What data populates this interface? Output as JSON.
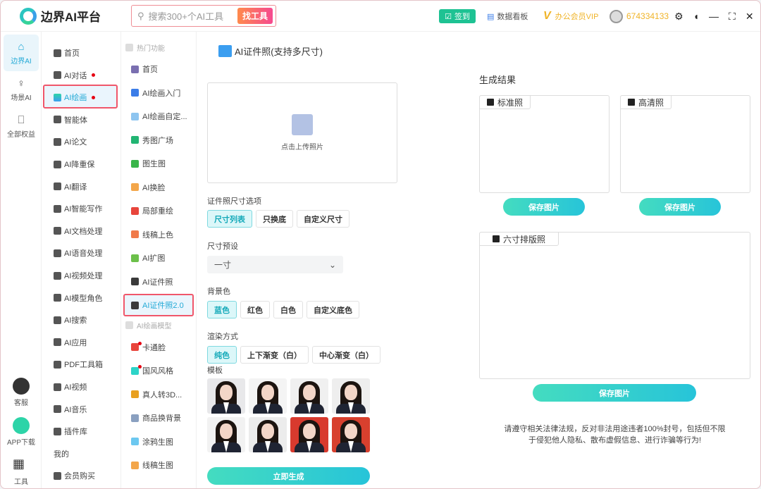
{
  "app": {
    "title": "边界AI平台"
  },
  "search": {
    "placeholder": "搜索300+个AI工具",
    "button": "找工具"
  },
  "toolbar": {
    "sign_in": "签到",
    "dashboard": "数据看板",
    "vip": "办公会员VIP",
    "user_id": "674334133"
  },
  "rail": {
    "items": [
      {
        "label": "边界AI",
        "icon": "home-icon",
        "active": true
      },
      {
        "label": "场景AI",
        "icon": "bulb-icon"
      },
      {
        "label": "全部权益",
        "icon": "bookmark-icon"
      }
    ],
    "bottom": [
      {
        "label": "客服",
        "icon": "headset-icon"
      },
      {
        "label": "APP下载",
        "icon": "phone-download-icon"
      },
      {
        "label": "工具",
        "icon": "grid-plus-icon"
      }
    ]
  },
  "nav1": {
    "items": [
      {
        "label": "首页",
        "icon": "home-icon"
      },
      {
        "label": "AI对话",
        "icon": "cube-icon",
        "dot": true
      },
      {
        "label": "AI绘画",
        "icon": "palette-icon",
        "dot": true,
        "active": true
      },
      {
        "label": "智能体",
        "icon": "robot-icon"
      },
      {
        "label": "AI论文",
        "icon": "document-icon"
      },
      {
        "label": "AI降重保",
        "icon": "list-icon"
      },
      {
        "label": "AI翻译",
        "icon": "translate-icon"
      },
      {
        "label": "AI智能写作",
        "icon": "pen-icon"
      },
      {
        "label": "AI文档处理",
        "icon": "text-icon"
      },
      {
        "label": "AI语音处理",
        "icon": "speaker-icon"
      },
      {
        "label": "AI视频处理",
        "icon": "video-icon"
      },
      {
        "label": "AI模型角色",
        "icon": "box-icon"
      },
      {
        "label": "AI搜索",
        "icon": "search-icon"
      },
      {
        "label": "AI应用",
        "icon": "apps-icon"
      },
      {
        "label": "PDF工具箱",
        "icon": "wrench-icon"
      },
      {
        "label": "AI视频",
        "icon": "play-icon"
      },
      {
        "label": "AI音乐",
        "icon": "music-icon"
      },
      {
        "label": "插件库",
        "icon": "plugin-icon"
      },
      {
        "label": "我的",
        "icon": ""
      },
      {
        "label": "会员购买",
        "icon": "user-icon"
      }
    ]
  },
  "nav2": {
    "sections": [
      {
        "title": "热门功能",
        "items": [
          {
            "label": "首页",
            "color": "#7a6fb0"
          },
          {
            "label": "AI绘画入门",
            "color": "#3b7de8"
          },
          {
            "label": "AI绘画自定...",
            "color": "#8ec5f0"
          },
          {
            "label": "秀图广场",
            "color": "#22b573"
          },
          {
            "label": "图生图",
            "color": "#39b54a"
          },
          {
            "label": "AI换脸",
            "color": "#f3a64a"
          },
          {
            "label": "局部重绘",
            "color": "#e8453c"
          },
          {
            "label": "线稿上色",
            "color": "#f07a4a"
          },
          {
            "label": "AI扩图",
            "color": "#6cc04a"
          },
          {
            "label": "AI证件照",
            "color": "#3a3a3a"
          },
          {
            "label": "AI证件照2.0",
            "color": "#3a3a3a",
            "active": true
          }
        ]
      },
      {
        "title": "AI绘画模型",
        "items": [
          {
            "label": "卡通脸",
            "color": "#e8453c",
            "dot": true
          },
          {
            "label": "国风风格",
            "color": "#2dd4c8",
            "dot": true
          },
          {
            "label": "真人转3D...",
            "color": "#e8a020"
          },
          {
            "label": "商品换背景",
            "color": "#8aa0c0"
          },
          {
            "label": "涂鸦生图",
            "color": "#6cc8f0"
          },
          {
            "label": "线稿生图",
            "color": "#f3a64a"
          }
        ]
      }
    ]
  },
  "page": {
    "title": "AI证件照(支持多尺寸)",
    "upload_text": "点击上传照片",
    "size_options": {
      "label": "证件照尺寸选项",
      "options": [
        "尺寸列表",
        "只换底",
        "自定义尺寸"
      ],
      "selected": 0
    },
    "size_preset": {
      "label": "尺寸预设",
      "value": "一寸"
    },
    "bg_color": {
      "label": "背景色",
      "options": [
        "蓝色",
        "红色",
        "白色",
        "自定义底色"
      ],
      "selected": 0
    },
    "render": {
      "label": "渲染方式",
      "options": [
        "纯色",
        "上下渐变（白）",
        "中心渐变（白）"
      ],
      "selected": 0
    },
    "template": {
      "label": "模板",
      "backgrounds": [
        "#e8e8ea",
        "#f4f4f4",
        "#f0f0f0",
        "#eeeeee",
        "#f2f2f2",
        "#ececec",
        "#d83a2e",
        "#d8402e"
      ]
    },
    "generate": "立即生成"
  },
  "result": {
    "title": "生成结果",
    "standard": "标准照",
    "hd": "高清照",
    "six_inch": "六寸排版照",
    "save": "保存图片",
    "notice1": "请遵守相关法律法规，反对非法用途违者100%封号，包括但不限",
    "notice2": "于侵犯他人隐私、散布虚假信息、进行诈骗等行为!"
  },
  "colors": {
    "accent": "#2bc6cf",
    "highlight": "#f0566a",
    "vip": "#f0b429"
  }
}
